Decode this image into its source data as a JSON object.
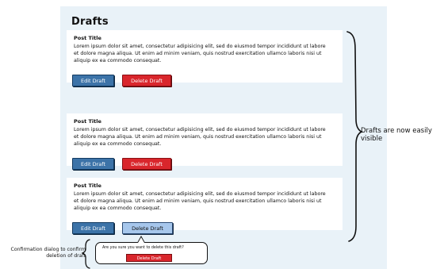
{
  "page_title": "Drafts",
  "drafts": [
    {
      "title": "Post Title",
      "body": "Lorem ipsum dolor sit amet, consectetur adipisicing elit, sed do eiusmod tempor incididunt ut labore et dolore magna aliqua. Ut enim ad minim veniam, quis nostrud exercitation ullamco laboris nisi ut aliquip ex ea commodo consequat.",
      "edit_label": "Edit Draft",
      "delete_label": "Delete Draft"
    },
    {
      "title": "Post Title",
      "body": "Lorem ipsum dolor sit amet, consectetur adipisicing elit, sed do eiusmod tempor incididunt ut labore et dolore magna aliqua. Ut enim ad minim veniam, quis nostrud exercitation ullamco laboris nisi ut aliquip ex ea commodo consequat.",
      "edit_label": "Edit Draft",
      "delete_label": "Delete Draft"
    },
    {
      "title": "Post Title",
      "body": "Lorem ipsum dolor sit amet, consectetur adipisicing elit, sed do eiusmod tempor incididunt ut labore et dolore magna aliqua. Ut enim ad minim veniam, quis nostrud exercitation ullamco laboris nisi ut aliquip ex ea commodo consequat.",
      "edit_label": "Edit Draft",
      "delete_label": "Delete Draft"
    }
  ],
  "dialog": {
    "message": "Are you sure you want to delete this draft?",
    "confirm_label": "Delete Draft"
  },
  "annotations": {
    "right": "Drafts are now easily visible",
    "left": "Confirmation dialog to confirm deletion of draft"
  },
  "colors": {
    "panel_bg": "#e9f2f8",
    "edit_button": "#3c73a8",
    "delete_button": "#d9262c",
    "delete_button_active": "#a7c7ec"
  }
}
